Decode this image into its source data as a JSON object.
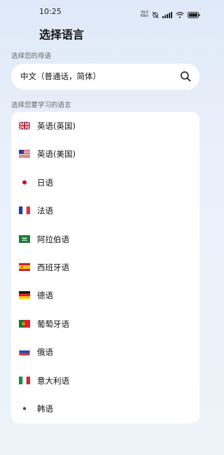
{
  "status_bar": {
    "time": "10:25",
    "net_speed_value": "34.0",
    "net_speed_unit": "KB/s",
    "icons": [
      "alarm-off-icon",
      "signal-icon",
      "wifi-icon",
      "battery-icon"
    ]
  },
  "page": {
    "title": "选择语言"
  },
  "native": {
    "label": "选择您的母语",
    "value": "中文（普通话，简体）",
    "icon": "search-icon"
  },
  "learn": {
    "label": "选择您要学习的语言",
    "languages": [
      {
        "label": "英语(英国)",
        "flag": "uk-flag-icon"
      },
      {
        "label": "英语(美国)",
        "flag": "us-flag-icon"
      },
      {
        "label": "日语",
        "flag": "japan-flag-icon"
      },
      {
        "label": "法语",
        "flag": "france-flag-icon"
      },
      {
        "label": "阿拉伯语",
        "flag": "saudi-arabia-flag-icon"
      },
      {
        "label": "西班牙语",
        "flag": "spain-flag-icon"
      },
      {
        "label": "德语",
        "flag": "germany-flag-icon"
      },
      {
        "label": "葡萄牙语",
        "flag": "portugal-flag-icon"
      },
      {
        "label": "俄语",
        "flag": "russia-flag-icon"
      },
      {
        "label": "意大利语",
        "flag": "italy-flag-icon"
      },
      {
        "label": "韩语",
        "flag": "korea-flag-icon"
      }
    ]
  }
}
